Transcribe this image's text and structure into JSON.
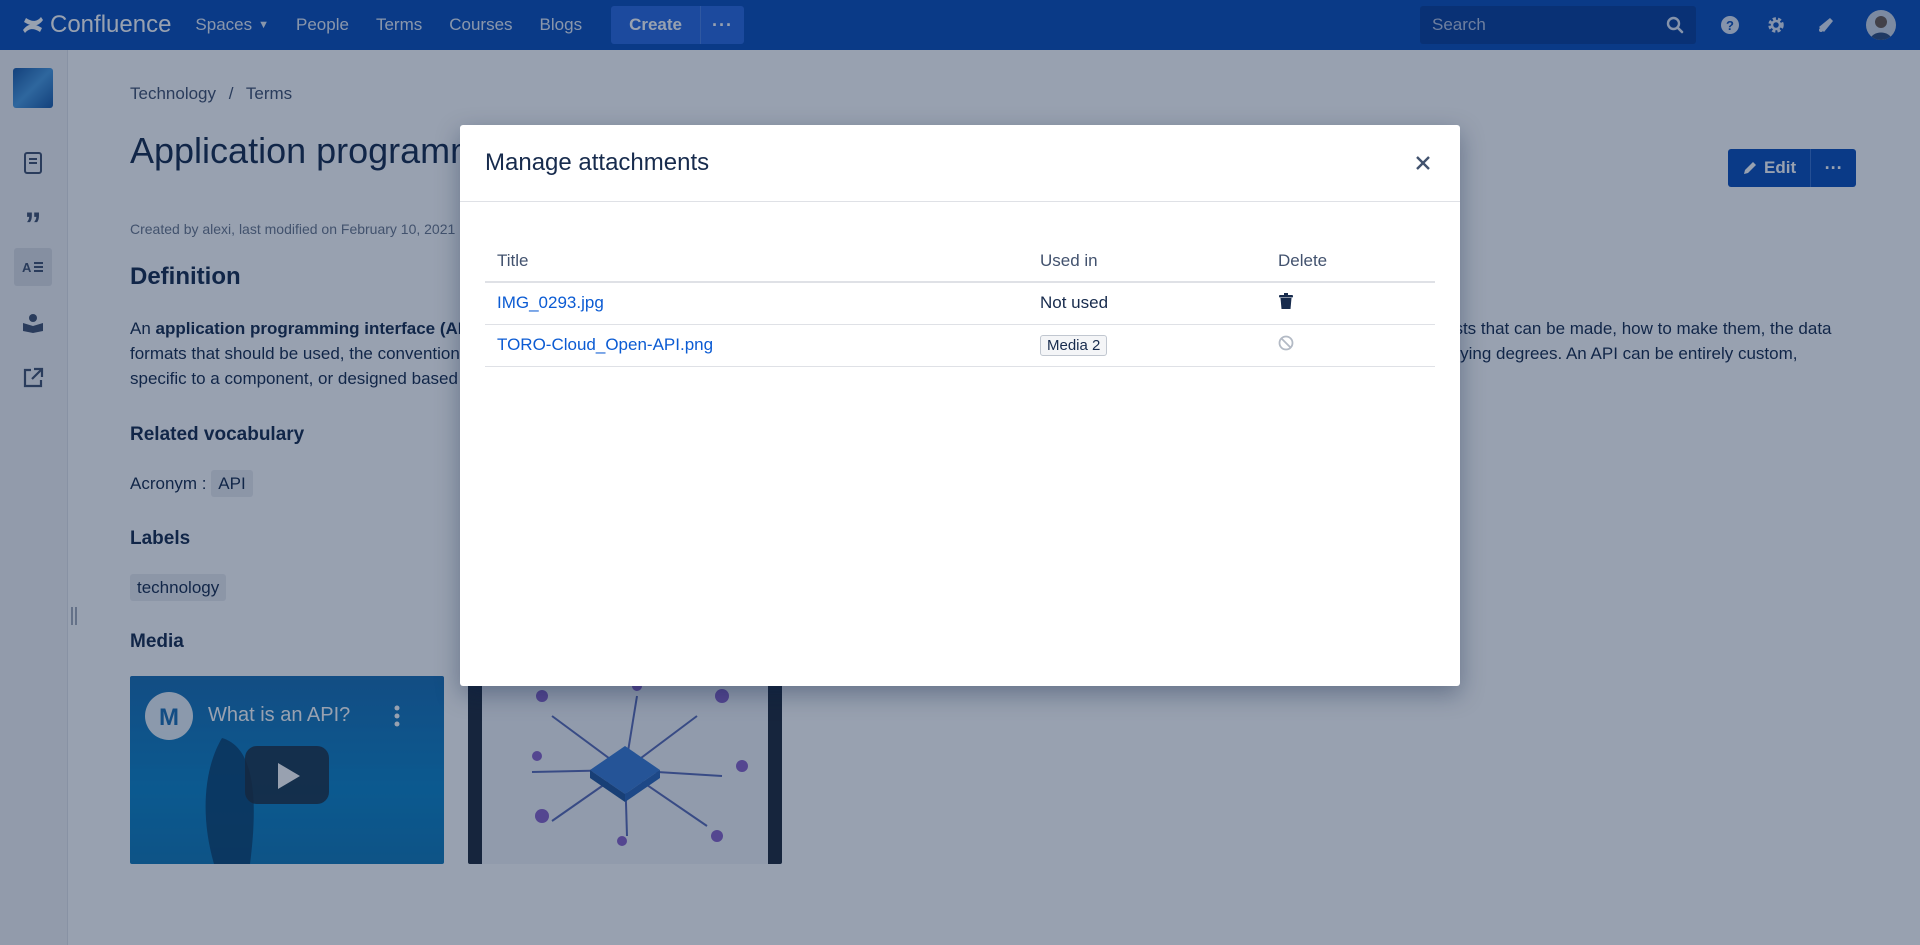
{
  "topnav": {
    "brand": "Confluence",
    "links": [
      "Spaces",
      "People",
      "Terms",
      "Courses",
      "Blogs"
    ],
    "create_label": "Create",
    "search_placeholder": "Search",
    "accent": "#0b4eb8"
  },
  "page": {
    "breadcrumb": [
      "Technology",
      "Terms"
    ],
    "title": "Application programming interface",
    "edit_label": "Edit",
    "byline": "Created by alexi, last modified on February 10, 2021",
    "definition_heading": "Definition",
    "para_line1_prefix": "An ",
    "para_line1_bold": "application programming interface (AP",
    "para_line2": "formats that should be used, the conventions",
    "para_line3": "specific to a component, or designed based",
    "para_right_line1": "ests that can be made, how to make them, the data",
    "para_right_line2": "arying degrees. An API can be entirely custom,",
    "related_heading": "Related vocabulary",
    "acronym_label": "Acronym :",
    "acronym_value": "API",
    "labels_heading": "Labels",
    "label_value": "technology",
    "media_heading": "Media",
    "video_title": "What is an API?"
  },
  "dialog": {
    "title": "Manage attachments",
    "columns": [
      "Title",
      "Used in",
      "Delete"
    ],
    "rows": [
      {
        "title": "IMG_0293.jpg",
        "used_in": "Not used",
        "delete": "trash-icon"
      },
      {
        "title": "TORO-Cloud_Open-API.png",
        "used_in": "Media 2",
        "delete": "disabled-icon"
      }
    ]
  }
}
